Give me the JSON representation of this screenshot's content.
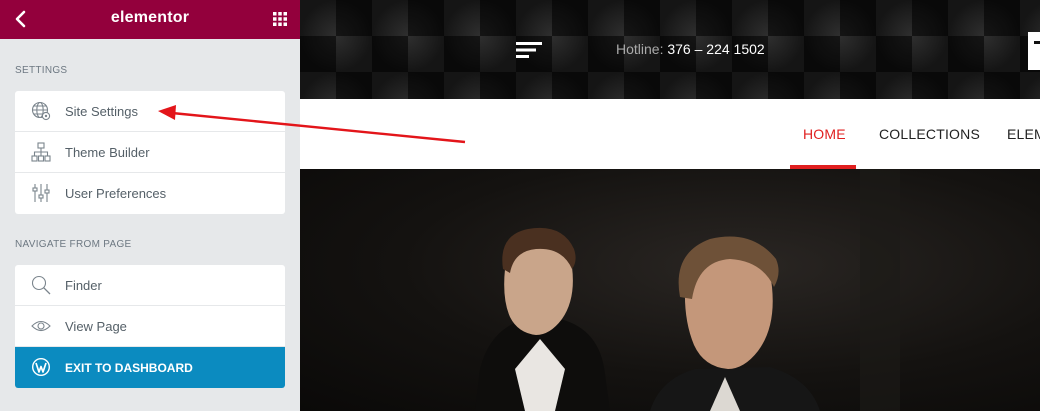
{
  "panel": {
    "brand": "elementor",
    "header_color": "#93003c",
    "settings_title": "SETTINGS",
    "settings_items": [
      {
        "label": "Site Settings",
        "icon": "globe-settings-icon"
      },
      {
        "label": "Theme Builder",
        "icon": "sitemap-icon"
      },
      {
        "label": "User Preferences",
        "icon": "sliders-icon"
      }
    ],
    "navigate_title": "NAVIGATE FROM PAGE",
    "navigate_items": [
      {
        "label": "Finder",
        "icon": "search-icon"
      },
      {
        "label": "View Page",
        "icon": "eye-icon"
      },
      {
        "label": "EXIT TO DASHBOARD",
        "icon": "wordpress-icon"
      }
    ],
    "exit_color": "#0b8bc0"
  },
  "site": {
    "hotline_label": "Hotline:",
    "hotline_number": "376 – 224 1502",
    "nav": [
      {
        "label": "HOME",
        "active": true
      },
      {
        "label": "COLLECTIONS",
        "active": false
      },
      {
        "label": "ELEM",
        "active": false
      }
    ],
    "accent_color": "#e01f1f"
  },
  "annotation": {
    "type": "arrow",
    "color": "#e3151a",
    "target": "site-settings-item"
  }
}
